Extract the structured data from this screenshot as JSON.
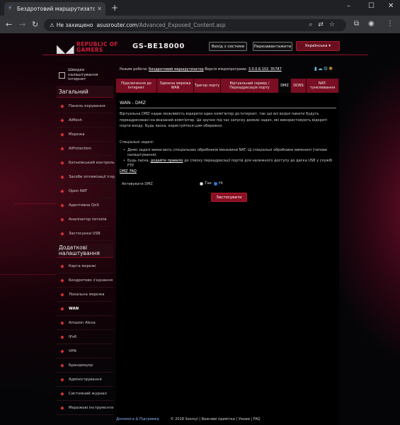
{
  "browser": {
    "tab_title": "Бездротовий маршрутизатор А",
    "new_tab": "+",
    "security_label": "Не захищено",
    "url_host": "asusrouter.com",
    "url_path": "/Advanced_Exposed_Content.asp",
    "win_min": "–",
    "win_max": "☐",
    "win_close": "✕"
  },
  "header": {
    "logo_top": "REPUBLIC OF",
    "logo_bottom": "GAMERS",
    "model": "GS-BE18000",
    "logout": "Вихід з системи",
    "reboot": "Перезавантажити",
    "language": "Українська"
  },
  "status": {
    "mode_label": "Режим роботи:",
    "mode_value": "Бездротовий маршрутизатор",
    "fw_label": "Версія мікропрограми:",
    "fw_value": "3.0.0.6.102_35787"
  },
  "sidebar": {
    "quick_setup": "Швидке налаштування Інтернет",
    "general_heading": "Загальний",
    "general_items": [
      {
        "label": "Панель керування",
        "icon": "dashboard-icon"
      },
      {
        "label": "AiMesh",
        "icon": "mesh-icon"
      },
      {
        "label": "Мережа",
        "icon": "network-icon"
      },
      {
        "label": "AiProtection",
        "icon": "shield-icon"
      },
      {
        "label": "Батьківський контроль",
        "icon": "parental-icon"
      },
      {
        "label": "Засоби оптимізації ігор",
        "icon": "gamepad-icon"
      },
      {
        "label": "Open NAT",
        "icon": "nat-icon"
      },
      {
        "label": "Адаптивна QoS",
        "icon": "qos-icon"
      },
      {
        "label": "Аналізатор потоків",
        "icon": "traffic-icon"
      },
      {
        "label": "Застосунки USB",
        "icon": "usb-icon"
      }
    ],
    "advanced_heading": "Додаткові налаштування",
    "advanced_items": [
      {
        "label": "Карта мережі",
        "icon": "map-icon"
      },
      {
        "label": "Бездротове з'єднання",
        "icon": "wifi-icon"
      },
      {
        "label": "Локальна мережа",
        "icon": "lan-icon"
      },
      {
        "label": "WAN",
        "icon": "globe-icon"
      },
      {
        "label": "Amazon Alexa",
        "icon": "alexa-icon"
      },
      {
        "label": "IPv6",
        "icon": "ipv6-icon"
      },
      {
        "label": "VPN",
        "icon": "vpn-icon"
      },
      {
        "label": "Брандмауер",
        "icon": "firewall-icon"
      },
      {
        "label": "Адміністрування",
        "icon": "admin-icon"
      },
      {
        "label": "Системний журнал",
        "icon": "log-icon"
      },
      {
        "label": "Мережеві інструменти",
        "icon": "tools-icon"
      }
    ]
  },
  "tabs": [
    {
      "label": "Підключення до Інтернет"
    },
    {
      "label": "Здвоєна мережа WAN"
    },
    {
      "label": "Тригер порту"
    },
    {
      "label": "Віртуальний сервер / Переадресація порту"
    },
    {
      "label": "DMZ"
    },
    {
      "label": "DDNS"
    },
    {
      "label": "NAT-тунелювання"
    }
  ],
  "content": {
    "title": "WAN - DMZ",
    "description": "Віртуальна DMZ надає можливість відкрити один комп'ютер до Інтернет, так що всі вхідні пакети будуть переадресовані на вказаний комп'ютер. Це зручно під час запуску деяких задач, які використовують відкриті порти входу. Будь ласка, користуйтеся цим обережно.",
    "special_heading": "Спеціальні задачі:",
    "bullet1": "Деякі задачі вимагають спеціальних обробників миналини NAT. Ці спеціальні обробники вимкнені (типове налаштування).",
    "bullet2_pre": "Будь ласка,",
    "bullet2_link": "додайте правило",
    "bullet2_post": "до списку переадресації портів для належного доступу до диска USB у службі FTP.",
    "faq": "DMZ_FAQ",
    "enable_label": "Активувати DMZ",
    "yes": "Так",
    "no": "Ні",
    "apply": "Застосувати"
  },
  "footer": {
    "help": "Допомога & Підтримка",
    "copyright": "© 2018 Sosroyl | Важливі примітки | Умови | FAQ"
  }
}
